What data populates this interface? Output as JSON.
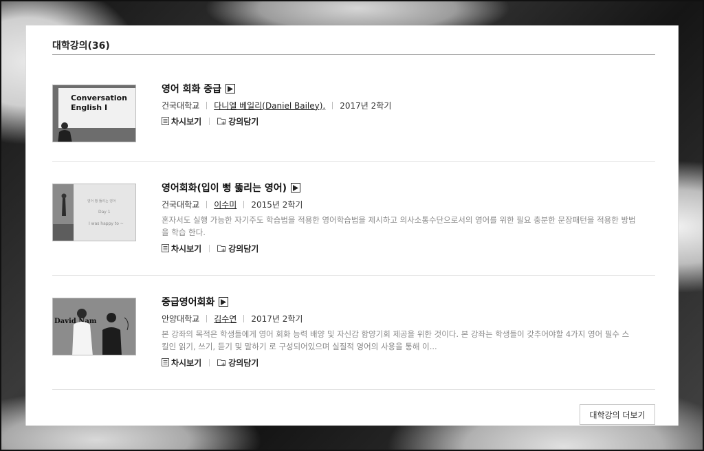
{
  "section": {
    "title": "대학강의(36)"
  },
  "lectures": [
    {
      "title": "영어 회화 중급",
      "university": "건국대학교",
      "professor": "다니엘 베일리(Daniel Bailey),",
      "term": "2017년 2학기",
      "description": "",
      "thumb_line1": "Conversation",
      "thumb_line2": "English I"
    },
    {
      "title": "영어회화(입이 뻥 뚫리는 영어)",
      "university": "건국대학교",
      "professor": "이수미",
      "term": "2015년 2학기",
      "description": "혼자서도 실행 가능한 자기주도 학습법을 적용한 영어학습법을 제시하고 의사소통수단으로서의 영어를 위한 필요 충분한 문장패턴을 적용한 방법을 학습 한다.",
      "thumb_line1": "Day 1",
      "thumb_line2": "I was happy to ~"
    },
    {
      "title": "중급영어회화",
      "university": "안양대학교",
      "professor": "김수연",
      "term": "2017년 2학기",
      "description": "본 강좌의 목적은 학생들에게 영어 회화 능력 배양 및 자신감 함양기회 제공을 위한 것이다. 본 강좌는 학생들이 갖추어야할 4가지 영어 필수 스킬인 읽기, 쓰기, 듣기 및 말하기 로 구성되어있으며 실질적 영어의 사용을 통해 이...",
      "thumb_line1": "David Nam",
      "thumb_line2": ""
    }
  ],
  "actions": {
    "syllabus": "차시보기",
    "save": "강의담기"
  },
  "more_button": "대학강의 더보기",
  "icons": {
    "play": "play-icon",
    "syllabus": "list-document-icon",
    "save": "folder-add-icon"
  }
}
